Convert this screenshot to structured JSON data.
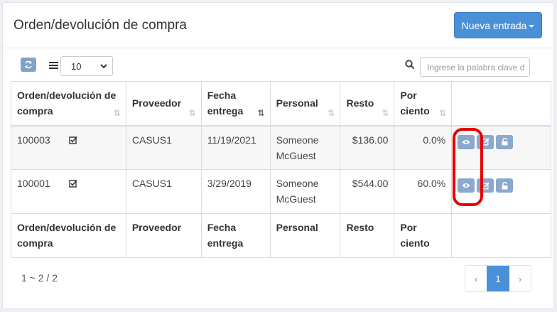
{
  "header": {
    "title": "Orden/devolución de compra",
    "new_entry_label": "Nueva entrada"
  },
  "toolbar": {
    "page_size": "10",
    "search_placeholder": "Ingrese la palabra clave d"
  },
  "table": {
    "columns": [
      {
        "label": "Orden/devolución de compra"
      },
      {
        "label": "Proveedor"
      },
      {
        "label": "Fecha entrega"
      },
      {
        "label": "Personal"
      },
      {
        "label": "Resto"
      },
      {
        "label": "Por ciento"
      }
    ],
    "rows": [
      {
        "order": "100003",
        "supplier": "CASUS1",
        "date": "11/19/2021",
        "staff": "Someone McGuest",
        "rest": "$136.00",
        "percent": "0.0%"
      },
      {
        "order": "100001",
        "supplier": "CASUS1",
        "date": "3/29/2019",
        "staff": "Someone McGuest",
        "rest": "$544.00",
        "percent": "60.0%"
      }
    ],
    "footer": [
      "Orden/devolución de compra",
      "Proveedor",
      "Fecha entrega",
      "Personal",
      "Resto",
      "Por ciento"
    ]
  },
  "pagination": {
    "info": "1 ~ 2 / 2",
    "prev": "‹",
    "current": "1",
    "next": "›"
  },
  "colors": {
    "primary": "#4a90d9",
    "action_button": "#8aa9cc",
    "highlight": "#e60000"
  },
  "icons": {
    "refresh": "refresh-icon",
    "list": "list-icon",
    "search": "search-icon",
    "check": "check-square-icon",
    "view": "eye-icon",
    "edit": "edit-icon",
    "unlock": "unlock-icon"
  }
}
